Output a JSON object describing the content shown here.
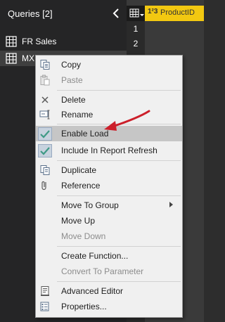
{
  "queries_pane": {
    "title": "Queries [2]",
    "items": [
      {
        "label": "FR Sales",
        "icon": "table-icon"
      },
      {
        "label": "MX",
        "icon": "table-icon"
      }
    ]
  },
  "grid": {
    "column_type": "1²3",
    "column_name": "ProductID",
    "row_numbers": [
      "1",
      "2"
    ]
  },
  "context_menu": {
    "items": [
      {
        "label": "Copy",
        "icon": "copy-icon",
        "enabled": true
      },
      {
        "label": "Paste",
        "icon": "paste-icon",
        "enabled": false
      },
      {
        "label": "Delete",
        "icon": "delete-icon",
        "enabled": true
      },
      {
        "label": "Rename",
        "icon": "rename-icon",
        "enabled": true
      },
      {
        "label": "Enable Load",
        "icon": "check-icon",
        "enabled": true,
        "checked": true,
        "highlighted": true
      },
      {
        "label": "Include In Report Refresh",
        "icon": "check-icon",
        "enabled": true,
        "checked": true
      },
      {
        "label": "Duplicate",
        "icon": "duplicate-icon",
        "enabled": true
      },
      {
        "label": "Reference",
        "icon": "reference-icon",
        "enabled": true
      },
      {
        "label": "Move To Group",
        "icon": "",
        "enabled": true,
        "submenu": true
      },
      {
        "label": "Move Up",
        "icon": "",
        "enabled": true
      },
      {
        "label": "Move Down",
        "icon": "",
        "enabled": false
      },
      {
        "label": "Create Function...",
        "icon": "",
        "enabled": true
      },
      {
        "label": "Convert To Parameter",
        "icon": "",
        "enabled": false
      },
      {
        "label": "Advanced Editor",
        "icon": "advanced-editor-icon",
        "enabled": true
      },
      {
        "label": "Properties...",
        "icon": "properties-icon",
        "enabled": true
      }
    ]
  },
  "colors": {
    "pane_bg": "#252526",
    "menu_bg": "#f0f0f0",
    "highlight": "#c6c6c6",
    "check_green": "#3f9a86",
    "column_header": "#f2c811",
    "annotation_arrow": "#cc1f2a"
  }
}
